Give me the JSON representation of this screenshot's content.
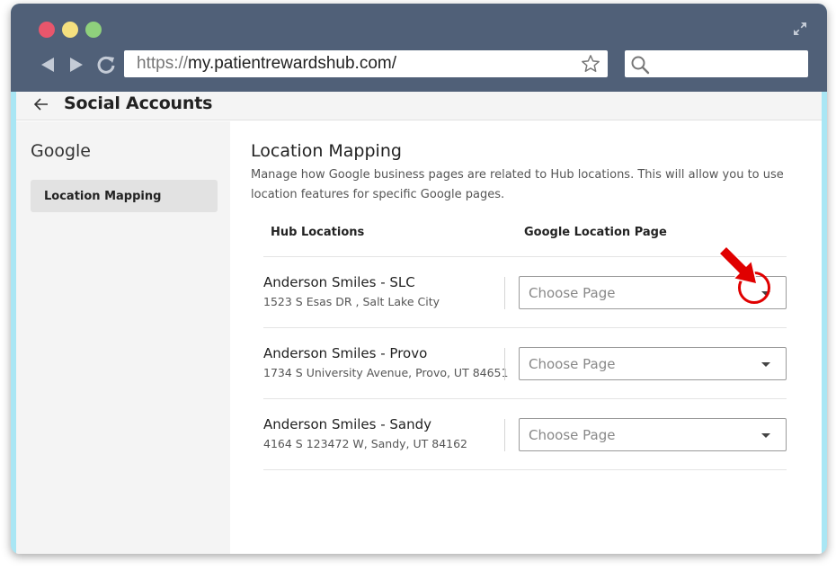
{
  "browser": {
    "url_scheme": "https://",
    "url_host": "my.patientrewardshub.com/",
    "search_value": ""
  },
  "app": {
    "header_title": "Social Accounts",
    "sidebar": {
      "section_title": "Google",
      "items": [
        {
          "label": "Location Mapping",
          "active": true
        }
      ]
    },
    "main": {
      "heading": "Location Mapping",
      "description": "Manage how Google business pages are related to Hub locations. This will allow you to use location features for specific Google pages.",
      "columns": {
        "hub": "Hub Locations",
        "google": "Google Location Page"
      },
      "rows": [
        {
          "name": "Anderson Smiles - SLC",
          "address": "1523 S Esas DR , Salt Lake City",
          "select_placeholder": "Choose Page"
        },
        {
          "name": "Anderson Smiles - Provo",
          "address": "1734 S University Avenue, Provo, UT 84651",
          "select_placeholder": "Choose Page"
        },
        {
          "name": "Anderson Smiles - Sandy",
          "address": "4164 S 123472 W, Sandy, UT 84162",
          "select_placeholder": "Choose Page"
        }
      ]
    }
  },
  "colors": {
    "chrome": "#506078",
    "accent_annotation": "#e00000"
  },
  "icons": [
    "expand-icon",
    "back-arrow-icon",
    "forward-arrow-icon",
    "reload-icon",
    "star-icon",
    "search-icon",
    "arrow-left-icon",
    "chevron-down-icon"
  ]
}
